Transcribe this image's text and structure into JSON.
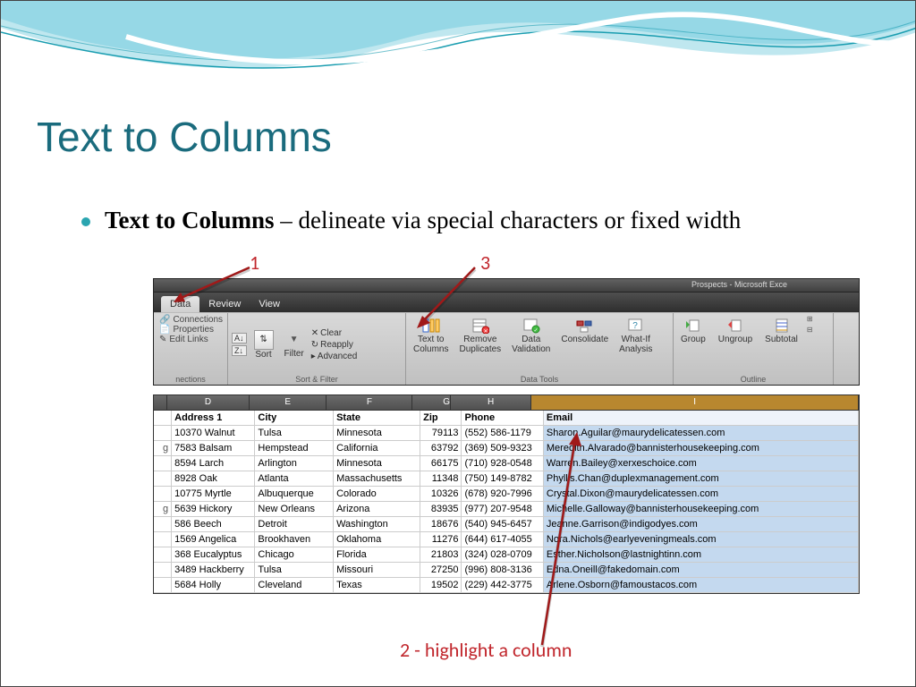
{
  "slide": {
    "title": "Text to Columns",
    "bullet_bold": "Text to Columns",
    "bullet_rest": " – delineate via special characters or fixed width"
  },
  "annotations": {
    "a1": "1",
    "a2": "2 - highlight a column",
    "a3": "3"
  },
  "ribbon": {
    "title_bar": "Prospects - Microsoft Exce",
    "tabs": {
      "data": "Data",
      "review": "Review",
      "view": "View"
    },
    "conn": {
      "connections": "Connections",
      "properties": "Properties",
      "edit_links": "Edit Links",
      "group": "nections"
    },
    "sort_az": "A↓Z",
    "sort_za": "Z↓A",
    "sort": "Sort",
    "filter": "Filter",
    "clear": "Clear",
    "reapply": "Reapply",
    "advanced": "Advanced",
    "sort_filter_group": "Sort & Filter",
    "text_to_cols": "Text to\nColumns",
    "remove_dup": "Remove\nDuplicates",
    "data_val": "Data\nValidation",
    "consolidate": "Consolidate",
    "whatif": "What-If\nAnalysis",
    "data_tools_group": "Data Tools",
    "group_btn": "Group",
    "ungroup": "Ungroup",
    "subtotal": "Subtotal",
    "outline_group": "Outline"
  },
  "grid": {
    "col_letters": [
      "",
      "D",
      "E",
      "F",
      "G",
      "H",
      "I"
    ],
    "headers": [
      "",
      "Address 1",
      "City",
      "State",
      "Zip",
      "Phone",
      "Email"
    ],
    "rows": [
      [
        "",
        "10370 Walnut",
        "Tulsa",
        "Minnesota",
        "79113",
        "(552) 586-1179",
        "Sharon.Aguilar@maurydelicatessen.com"
      ],
      [
        "g",
        "7583 Balsam",
        "Hempstead",
        "California",
        "63792",
        "(369) 509-9323",
        "Meredith.Alvarado@bannisterhousekeeping.com"
      ],
      [
        "",
        "8594 Larch",
        "Arlington",
        "Minnesota",
        "66175",
        "(710) 928-0548",
        "Warren.Bailey@xerxeschoice.com"
      ],
      [
        "",
        "8928 Oak",
        "Atlanta",
        "Massachusetts",
        "11348",
        "(750) 149-8782",
        "Phyllis.Chan@duplexmanagement.com"
      ],
      [
        "",
        "10775 Myrtle",
        "Albuquerque",
        "Colorado",
        "10326",
        "(678) 920-7996",
        "Crystal.Dixon@maurydelicatessen.com"
      ],
      [
        "g",
        "5639 Hickory",
        "New Orleans",
        "Arizona",
        "83935",
        "(977) 207-9548",
        "Michelle.Galloway@bannisterhousekeeping.com"
      ],
      [
        "",
        "586 Beech",
        "Detroit",
        "Washington",
        "18676",
        "(540) 945-6457",
        "Jeanne.Garrison@indigodyes.com"
      ],
      [
        "",
        "1569 Angelica",
        "Brookhaven",
        "Oklahoma",
        "11276",
        "(644) 617-4055",
        "Nora.Nichols@earlyeveningmeals.com"
      ],
      [
        "",
        "368 Eucalyptus",
        "Chicago",
        "Florida",
        "21803",
        "(324) 028-0709",
        "Esther.Nicholson@lastnightinn.com"
      ],
      [
        "",
        "3489 Hackberry",
        "Tulsa",
        "Missouri",
        "27250",
        "(996) 808-3136",
        "Edna.Oneill@fakedomain.com"
      ],
      [
        "",
        "5684 Holly",
        "Cleveland",
        "Texas",
        "19502",
        "(229) 442-3775",
        "Arlene.Osborn@famoustacos.com"
      ]
    ]
  }
}
